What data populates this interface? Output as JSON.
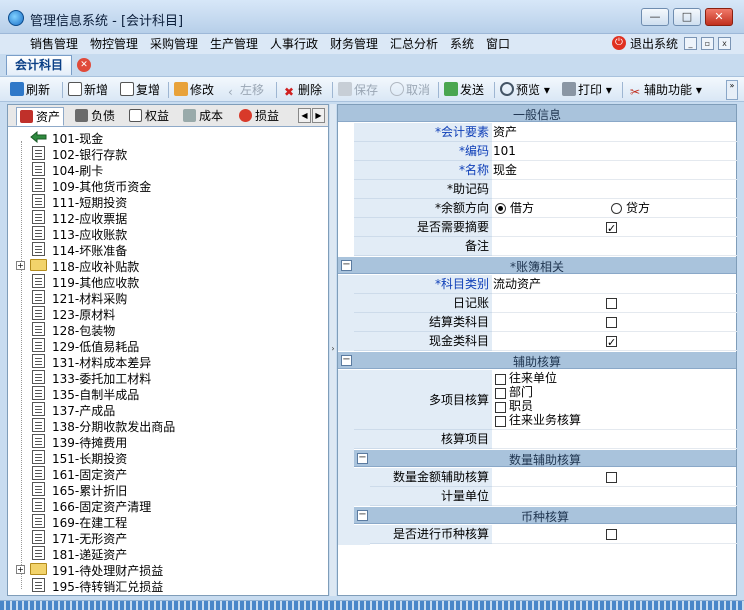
{
  "window": {
    "title": "管理信息系统 - [会计科目]",
    "minimize": "—",
    "maximize": "□",
    "close": "✕"
  },
  "menu": {
    "items": [
      "销售管理",
      "物控管理",
      "采购管理",
      "生产管理",
      "人事行政",
      "财务管理",
      "汇总分析",
      "系统",
      "窗口"
    ],
    "exit_label": "退出系统"
  },
  "doc_tab": {
    "label": "会计科目",
    "close": "✕"
  },
  "toolbar": {
    "refresh": "刷新",
    "add": "新增",
    "copy": "复增",
    "edit": "修改",
    "move_left": "左移",
    "delete": "删除",
    "save": "保存",
    "cancel": "取消",
    "send": "发送",
    "preview": "预览",
    "print": "打印",
    "assist": "辅助功能"
  },
  "account_tabs": {
    "items": [
      "资产",
      "负债",
      "权益",
      "成本",
      "损益"
    ],
    "active": "资产"
  },
  "tree": {
    "items": [
      {
        "label": "101-现金",
        "type": "root"
      },
      {
        "label": "102-银行存款",
        "type": "doc"
      },
      {
        "label": "104-刷卡",
        "type": "doc"
      },
      {
        "label": "109-其他货币资金",
        "type": "doc"
      },
      {
        "label": "111-短期投资",
        "type": "doc"
      },
      {
        "label": "112-应收票据",
        "type": "doc"
      },
      {
        "label": "113-应收账款",
        "type": "doc"
      },
      {
        "label": "114-坏账准备",
        "type": "doc"
      },
      {
        "label": "118-应收补贴款",
        "type": "folder"
      },
      {
        "label": "119-其他应收款",
        "type": "doc"
      },
      {
        "label": "121-材料采购",
        "type": "doc"
      },
      {
        "label": "123-原材料",
        "type": "doc"
      },
      {
        "label": "128-包装物",
        "type": "doc"
      },
      {
        "label": "129-低值易耗品",
        "type": "doc"
      },
      {
        "label": "131-材料成本差异",
        "type": "doc"
      },
      {
        "label": "133-委托加工材料",
        "type": "doc"
      },
      {
        "label": "135-自制半成品",
        "type": "doc"
      },
      {
        "label": "137-产成品",
        "type": "doc"
      },
      {
        "label": "138-分期收款发出商品",
        "type": "doc"
      },
      {
        "label": "139-待摊费用",
        "type": "doc"
      },
      {
        "label": "151-长期投资",
        "type": "doc"
      },
      {
        "label": "161-固定资产",
        "type": "doc"
      },
      {
        "label": "165-累计折旧",
        "type": "doc"
      },
      {
        "label": "166-固定资产清理",
        "type": "doc"
      },
      {
        "label": "169-在建工程",
        "type": "doc"
      },
      {
        "label": "171-无形资产",
        "type": "doc"
      },
      {
        "label": "181-递延资产",
        "type": "doc"
      },
      {
        "label": "191-待处理财产损益",
        "type": "folder"
      },
      {
        "label": "195-待转销汇兑损益",
        "type": "doc"
      }
    ]
  },
  "props": {
    "general": {
      "title": "一般信息",
      "element_label": "*会计要素",
      "element_value": "资产",
      "code_label": "*编码",
      "code_value": "101",
      "name_label": "*名称",
      "name_value": "现金",
      "mnemonic_label": "*助记码",
      "mnemonic_value": "",
      "balance_label": "*余额方向",
      "debit": "借方",
      "credit": "贷方",
      "need_summary_label": "是否需要摘要",
      "remark_label": "备注"
    },
    "ledger": {
      "title": "*账簿相关",
      "category_label": "*科目类别",
      "category_value": "流动资产",
      "journal_label": "日记账",
      "settle_label": "结算类科目",
      "cash_label": "现金类科目"
    },
    "aux": {
      "title": "辅助核算",
      "multi_label": "多项目核算",
      "options": [
        "往来单位",
        "部门",
        "职员",
        "往来业务核算"
      ],
      "items_label": "核算项目",
      "qty_title": "数量辅助核算",
      "qty_amount_label": "数量金额辅助核算",
      "unit_label": "计量单位",
      "currency_title": "币种核算",
      "currency_label": "是否进行币种核算"
    }
  },
  "state": {
    "balance_direction": "借方",
    "need_summary": true,
    "journal": false,
    "settle": false,
    "cash": true,
    "aux_options_checked": [
      false,
      false,
      false,
      false
    ],
    "qty_amount": false,
    "currency": false
  }
}
